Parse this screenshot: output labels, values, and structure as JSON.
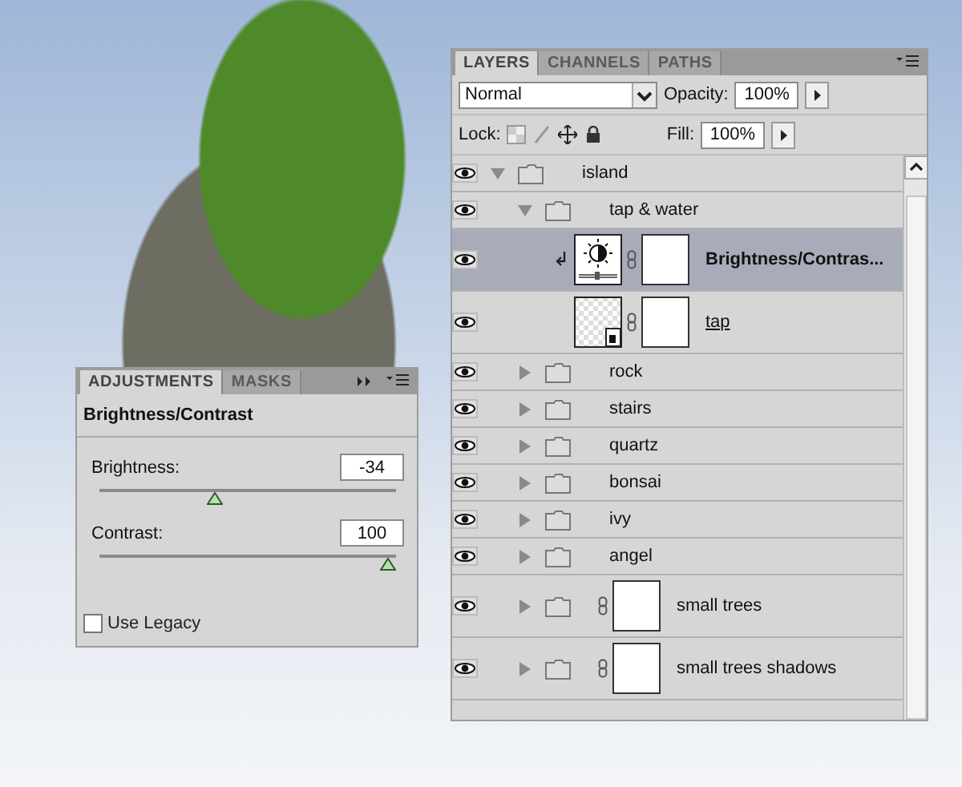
{
  "layers_panel": {
    "tabs": [
      {
        "label": "LAYERS",
        "selected": true
      },
      {
        "label": "CHANNELS",
        "selected": false
      },
      {
        "label": "PATHS",
        "selected": false
      }
    ],
    "blend_mode": "Normal",
    "opacity_label": "Opacity:",
    "opacity": "100%",
    "lock_label": "Lock:",
    "fill_label": "Fill:",
    "fill": "100%",
    "layers": [
      {
        "name": "island",
        "kind": "group",
        "expanded": true,
        "selected": false,
        "clipped": false,
        "mask": false,
        "children": [
          {
            "name": "tap & water",
            "kind": "group",
            "expanded": true,
            "selected": false,
            "clipped": false,
            "mask": false,
            "children": [
              {
                "name": "Brightness/Contras...",
                "kind": "adjustment",
                "selected": true,
                "clipped": true,
                "mask": true
              },
              {
                "name": "tap",
                "kind": "smart",
                "selected": false,
                "clipped": false,
                "mask": true
              }
            ]
          },
          {
            "name": "rock",
            "kind": "group",
            "expanded": false,
            "selected": false,
            "clipped": false,
            "mask": false
          },
          {
            "name": "stairs",
            "kind": "group",
            "expanded": false,
            "selected": false,
            "clipped": false,
            "mask": false
          },
          {
            "name": "quartz",
            "kind": "group",
            "expanded": false,
            "selected": false,
            "clipped": false,
            "mask": false
          },
          {
            "name": "bonsai",
            "kind": "group",
            "expanded": false,
            "selected": false,
            "clipped": false,
            "mask": false
          },
          {
            "name": "ivy",
            "kind": "group",
            "expanded": false,
            "selected": false,
            "clipped": false,
            "mask": false
          },
          {
            "name": "angel",
            "kind": "group",
            "expanded": false,
            "selected": false,
            "clipped": false,
            "mask": false
          },
          {
            "name": "small trees",
            "kind": "group",
            "expanded": false,
            "selected": false,
            "clipped": false,
            "mask": true
          },
          {
            "name": "small trees shadows",
            "kind": "group",
            "expanded": false,
            "selected": false,
            "clipped": false,
            "mask": true
          }
        ]
      }
    ]
  },
  "adjustments_panel": {
    "tabs": [
      {
        "label": "ADJUSTMENTS",
        "selected": true
      },
      {
        "label": "MASKS",
        "selected": false
      }
    ],
    "title": "Brightness/Contrast",
    "sliders": [
      {
        "label": "Brightness:",
        "value": "-34",
        "level": 0.38
      },
      {
        "label": "Contrast:",
        "value": "100",
        "level": 1
      }
    ],
    "use_legacy": {
      "label": "Use Legacy",
      "checked": false
    }
  }
}
